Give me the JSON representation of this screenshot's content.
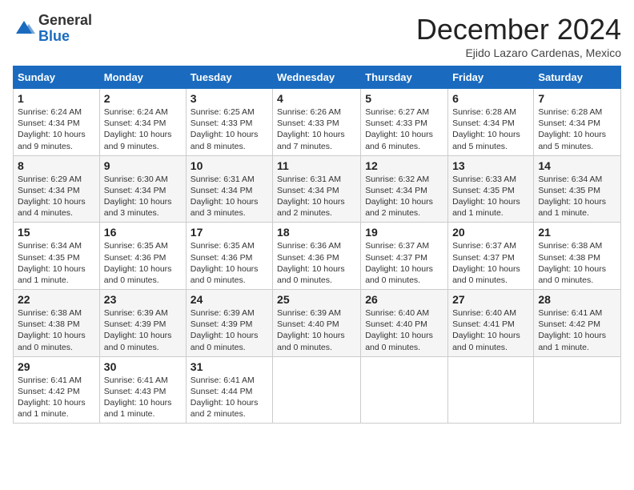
{
  "header": {
    "logo_general": "General",
    "logo_blue": "Blue",
    "month_title": "December 2024",
    "location": "Ejido Lazaro Cardenas, Mexico"
  },
  "calendar": {
    "days_of_week": [
      "Sunday",
      "Monday",
      "Tuesday",
      "Wednesday",
      "Thursday",
      "Friday",
      "Saturday"
    ],
    "weeks": [
      [
        {
          "day": "1",
          "sunrise": "6:24 AM",
          "sunset": "4:34 PM",
          "daylight": "10 hours and 9 minutes."
        },
        {
          "day": "2",
          "sunrise": "6:24 AM",
          "sunset": "4:34 PM",
          "daylight": "10 hours and 9 minutes."
        },
        {
          "day": "3",
          "sunrise": "6:25 AM",
          "sunset": "4:33 PM",
          "daylight": "10 hours and 8 minutes."
        },
        {
          "day": "4",
          "sunrise": "6:26 AM",
          "sunset": "4:33 PM",
          "daylight": "10 hours and 7 minutes."
        },
        {
          "day": "5",
          "sunrise": "6:27 AM",
          "sunset": "4:33 PM",
          "daylight": "10 hours and 6 minutes."
        },
        {
          "day": "6",
          "sunrise": "6:28 AM",
          "sunset": "4:34 PM",
          "daylight": "10 hours and 5 minutes."
        },
        {
          "day": "7",
          "sunrise": "6:28 AM",
          "sunset": "4:34 PM",
          "daylight": "10 hours and 5 minutes."
        }
      ],
      [
        {
          "day": "8",
          "sunrise": "6:29 AM",
          "sunset": "4:34 PM",
          "daylight": "10 hours and 4 minutes."
        },
        {
          "day": "9",
          "sunrise": "6:30 AM",
          "sunset": "4:34 PM",
          "daylight": "10 hours and 3 minutes."
        },
        {
          "day": "10",
          "sunrise": "6:31 AM",
          "sunset": "4:34 PM",
          "daylight": "10 hours and 3 minutes."
        },
        {
          "day": "11",
          "sunrise": "6:31 AM",
          "sunset": "4:34 PM",
          "daylight": "10 hours and 2 minutes."
        },
        {
          "day": "12",
          "sunrise": "6:32 AM",
          "sunset": "4:34 PM",
          "daylight": "10 hours and 2 minutes."
        },
        {
          "day": "13",
          "sunrise": "6:33 AM",
          "sunset": "4:35 PM",
          "daylight": "10 hours and 1 minute."
        },
        {
          "day": "14",
          "sunrise": "6:34 AM",
          "sunset": "4:35 PM",
          "daylight": "10 hours and 1 minute."
        }
      ],
      [
        {
          "day": "15",
          "sunrise": "6:34 AM",
          "sunset": "4:35 PM",
          "daylight": "10 hours and 1 minute."
        },
        {
          "day": "16",
          "sunrise": "6:35 AM",
          "sunset": "4:36 PM",
          "daylight": "10 hours and 0 minutes."
        },
        {
          "day": "17",
          "sunrise": "6:35 AM",
          "sunset": "4:36 PM",
          "daylight": "10 hours and 0 minutes."
        },
        {
          "day": "18",
          "sunrise": "6:36 AM",
          "sunset": "4:36 PM",
          "daylight": "10 hours and 0 minutes."
        },
        {
          "day": "19",
          "sunrise": "6:37 AM",
          "sunset": "4:37 PM",
          "daylight": "10 hours and 0 minutes."
        },
        {
          "day": "20",
          "sunrise": "6:37 AM",
          "sunset": "4:37 PM",
          "daylight": "10 hours and 0 minutes."
        },
        {
          "day": "21",
          "sunrise": "6:38 AM",
          "sunset": "4:38 PM",
          "daylight": "10 hours and 0 minutes."
        }
      ],
      [
        {
          "day": "22",
          "sunrise": "6:38 AM",
          "sunset": "4:38 PM",
          "daylight": "10 hours and 0 minutes."
        },
        {
          "day": "23",
          "sunrise": "6:39 AM",
          "sunset": "4:39 PM",
          "daylight": "10 hours and 0 minutes."
        },
        {
          "day": "24",
          "sunrise": "6:39 AM",
          "sunset": "4:39 PM",
          "daylight": "10 hours and 0 minutes."
        },
        {
          "day": "25",
          "sunrise": "6:39 AM",
          "sunset": "4:40 PM",
          "daylight": "10 hours and 0 minutes."
        },
        {
          "day": "26",
          "sunrise": "6:40 AM",
          "sunset": "4:40 PM",
          "daylight": "10 hours and 0 minutes."
        },
        {
          "day": "27",
          "sunrise": "6:40 AM",
          "sunset": "4:41 PM",
          "daylight": "10 hours and 0 minutes."
        },
        {
          "day": "28",
          "sunrise": "6:41 AM",
          "sunset": "4:42 PM",
          "daylight": "10 hours and 1 minute."
        }
      ],
      [
        {
          "day": "29",
          "sunrise": "6:41 AM",
          "sunset": "4:42 PM",
          "daylight": "10 hours and 1 minute."
        },
        {
          "day": "30",
          "sunrise": "6:41 AM",
          "sunset": "4:43 PM",
          "daylight": "10 hours and 1 minute."
        },
        {
          "day": "31",
          "sunrise": "6:41 AM",
          "sunset": "4:44 PM",
          "daylight": "10 hours and 2 minutes."
        },
        null,
        null,
        null,
        null
      ]
    ]
  }
}
